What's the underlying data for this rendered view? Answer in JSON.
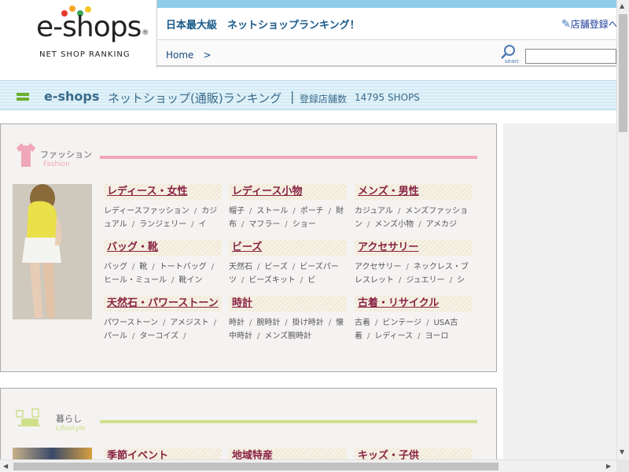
{
  "header": {
    "logo_text": "e-shops",
    "logo_reg": "®",
    "logo_sub": "NET SHOP RANKING",
    "catch": "日本最大級　ネットショップランキング！",
    "register_label": "店舗登録へ",
    "breadcrumb": "Home　>",
    "search_label": "search",
    "search_placeholder": ""
  },
  "band": {
    "title": "e-shops",
    "subtitle": "ネットショップ(通販)ランキング",
    "separator": "|",
    "count_label": "登録店舗数",
    "count": "14795 SHOPS"
  },
  "colors": {
    "fashion_accent": "#f0a7b8",
    "life_accent": "#cfe08a",
    "logo_dots": [
      "#e8382c",
      "#f5a623",
      "#3aa757",
      "#f6c623"
    ]
  },
  "sections": [
    {
      "id": "fashion",
      "jp": "ファッション",
      "en": "Fashion",
      "icon": "shirt-icon",
      "cells": [
        {
          "title": "レディース・女性",
          "links": [
            "レディースファッション",
            "カジュアル",
            "ランジェリー",
            "イ"
          ]
        },
        {
          "title": "レディース小物",
          "links": [
            "帽子",
            "ストール",
            "ポーチ",
            "財布",
            "マフラー",
            "ショー"
          ]
        },
        {
          "title": "メンズ・男性",
          "links": [
            "カジュアル",
            "メンズファッション",
            "メンズ小物",
            "アメカジ"
          ]
        },
        {
          "title": "バッグ・靴",
          "links": [
            "バッグ",
            "靴",
            "トートバッグ",
            "ヒール・ミュール",
            "靴イン"
          ]
        },
        {
          "title": "ビーズ",
          "links": [
            "天然石",
            "ビーズ",
            "ビーズパーツ",
            "ビーズキット",
            "ビ"
          ]
        },
        {
          "title": "アクセサリー",
          "links": [
            "アクセサリー",
            "ネックレス・ブレスレット",
            "ジュエリー",
            "シ"
          ]
        },
        {
          "title": "天然石・パワーストーン",
          "links": [
            "パワーストーン",
            "アメジスト",
            "パール",
            "ターコイズ",
            ""
          ]
        },
        {
          "title": "時計",
          "links": [
            "時計",
            "腕時計",
            "掛け時計",
            "懐中時計",
            "メンズ腕時計"
          ]
        },
        {
          "title": "古着・リサイクル",
          "links": [
            "古着",
            "ビンテージ",
            "USA古着",
            "レディース",
            "ヨーロ"
          ]
        }
      ]
    },
    {
      "id": "life",
      "jp": "暮らし",
      "en": "Lifestyle",
      "icon": "living-room-icon",
      "cells": [
        {
          "title": "季節イベント",
          "links": []
        },
        {
          "title": "地域特産",
          "links": []
        },
        {
          "title": "キッズ・子供",
          "links": []
        }
      ]
    }
  ]
}
